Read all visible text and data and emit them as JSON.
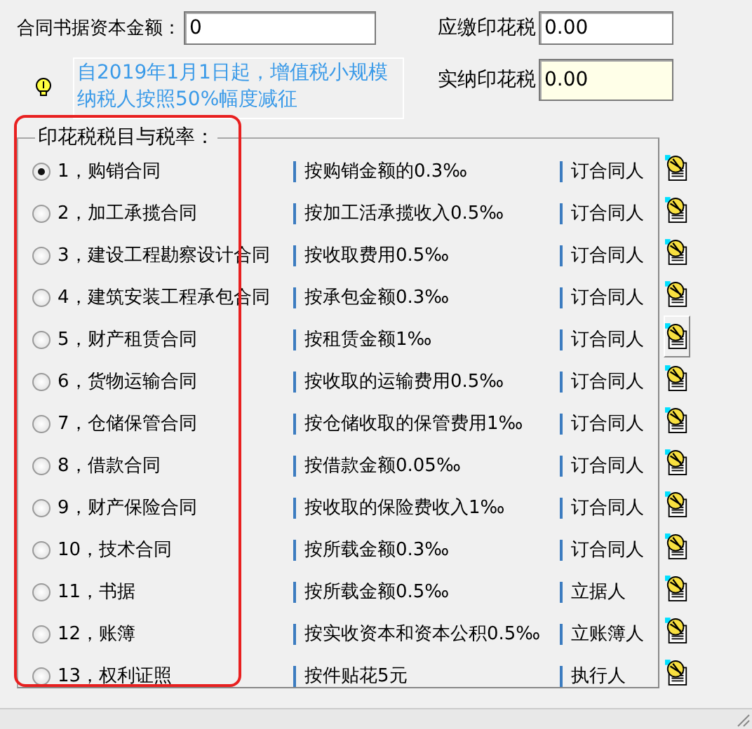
{
  "form": {
    "capital_label": "合同书据资本金额：",
    "capital_value": "0",
    "due_label": "应缴印花税",
    "due_value": "0.00",
    "paid_label": "实纳印花税",
    "paid_value": "0.00",
    "notice": "自2019年1月1日起，增值税小规模纳税人按照50%幅度减征"
  },
  "group": {
    "title": "印花税税目与税率：",
    "rows": [
      {
        "label": "1，购销合同",
        "rate": "按购销金额的0.3‰",
        "payer": "订合同人",
        "selected": true,
        "icon_raised": false
      },
      {
        "label": "2，加工承揽合同",
        "rate": "按加工活承揽收入0.5‰",
        "payer": "订合同人",
        "selected": false,
        "icon_raised": false
      },
      {
        "label": "3，建设工程勘察设计合同",
        "rate": "按收取费用0.5‰",
        "payer": "订合同人",
        "selected": false,
        "icon_raised": false
      },
      {
        "label": "4，建筑安装工程承包合同",
        "rate": "按承包金额0.3‰",
        "payer": "订合同人",
        "selected": false,
        "icon_raised": false
      },
      {
        "label": "5，财产租赁合同",
        "rate": "按租赁金额1‰",
        "payer": "订合同人",
        "selected": false,
        "icon_raised": true
      },
      {
        "label": "6，货物运输合同",
        "rate": "按收取的运输费用0.5‰",
        "payer": "订合同人",
        "selected": false,
        "icon_raised": false
      },
      {
        "label": "7，仓储保管合同",
        "rate": "按仓储收取的保管费用1‰",
        "payer": "订合同人",
        "selected": false,
        "icon_raised": false
      },
      {
        "label": "8，借款合同",
        "rate": "按借款金额0.05‰",
        "payer": "订合同人",
        "selected": false,
        "icon_raised": false
      },
      {
        "label": "9，财产保险合同",
        "rate": "按收取的保险费收入1‰",
        "payer": "订合同人",
        "selected": false,
        "icon_raised": false
      },
      {
        "label": "10，技术合同",
        "rate": "按所载金额0.3‰",
        "payer": "订合同人",
        "selected": false,
        "icon_raised": false
      },
      {
        "label": "11，书据",
        "rate": "按所载金额0.5‰",
        "payer": "立据人",
        "selected": false,
        "icon_raised": false
      },
      {
        "label": "12，账簿",
        "rate": "按实收资本和资本公积0.5‰",
        "payer": "立账簿人",
        "selected": false,
        "icon_raised": false
      },
      {
        "label": "13，权利证照",
        "rate": "按件贴花5元",
        "payer": "执行人",
        "selected": false,
        "icon_raised": false
      }
    ]
  }
}
